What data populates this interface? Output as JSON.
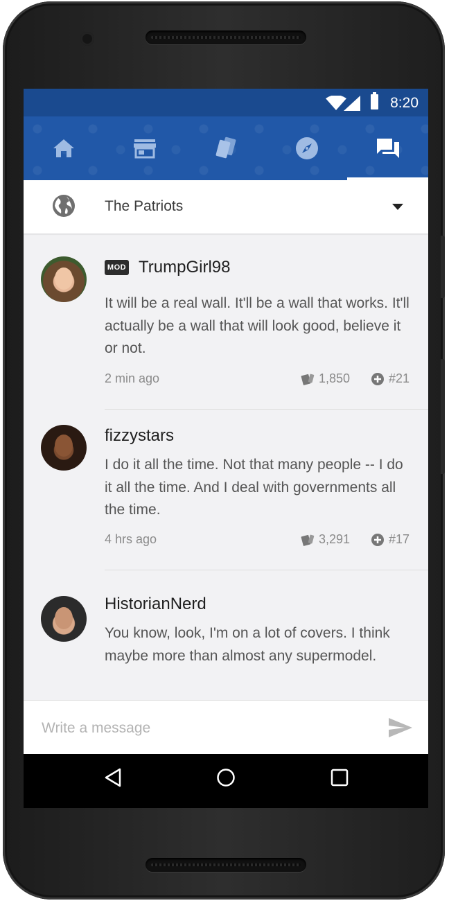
{
  "statusbar": {
    "time": "8:20"
  },
  "tabs": [
    {
      "name": "home",
      "icon": "home-icon"
    },
    {
      "name": "store",
      "icon": "store-icon"
    },
    {
      "name": "cards",
      "icon": "cards-icon"
    },
    {
      "name": "explore",
      "icon": "compass-icon"
    },
    {
      "name": "chat",
      "icon": "chat-icon",
      "active": true
    }
  ],
  "group": {
    "name": "The Patriots",
    "icon": "globe-icon"
  },
  "messages": [
    {
      "username": "TrumpGirl98",
      "badge": "MOD",
      "text": "It will be a real wall. It'll be a wall that works. It'll actually be a wall that will look good, believe it or not.",
      "time": "2 min ago",
      "likes": "1,850",
      "rank": "#21"
    },
    {
      "username": "fizzystars",
      "text": "I do it all the time. Not that many people -- I do it all the time. And I deal with governments all the time.",
      "time": "4 hrs ago",
      "likes": "3,291",
      "rank": "#17"
    },
    {
      "username": "HistorianNerd",
      "text": "You know, look, I'm on a lot of covers. I think maybe more than almost any supermodel."
    }
  ],
  "composer": {
    "placeholder": "Write a message"
  },
  "colors": {
    "header_blue": "#2158a8",
    "status_blue": "#1a4a8f"
  }
}
